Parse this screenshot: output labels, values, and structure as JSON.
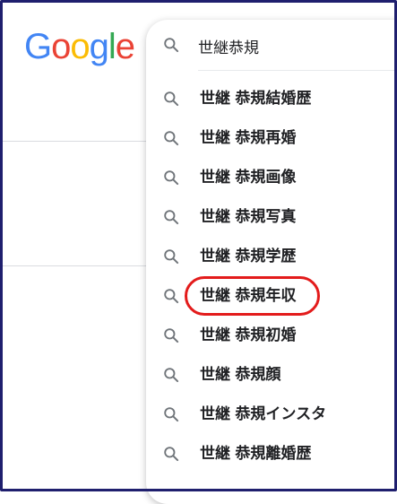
{
  "logo": {
    "text": "Google",
    "letters": [
      {
        "ch": "G",
        "color": "#4285F4"
      },
      {
        "ch": "o",
        "color": "#EA4335"
      },
      {
        "ch": "o",
        "color": "#FBBC05"
      },
      {
        "ch": "g",
        "color": "#4285F4"
      },
      {
        "ch": "l",
        "color": "#34A853"
      },
      {
        "ch": "e",
        "color": "#EA4335"
      }
    ]
  },
  "search": {
    "value": "世継恭規",
    "icon": "search-icon"
  },
  "suggestions": [
    {
      "query": "世継",
      "completion": "恭規結婚歴"
    },
    {
      "query": "世継",
      "completion": "恭規再婚"
    },
    {
      "query": "世継",
      "completion": "恭規画像"
    },
    {
      "query": "世継",
      "completion": "恭規写真"
    },
    {
      "query": "世継",
      "completion": "恭規学歴"
    },
    {
      "query": "世継",
      "completion": "恭規年収",
      "highlighted": true
    },
    {
      "query": "世継",
      "completion": "恭規初婚"
    },
    {
      "query": "世継",
      "completion": "恭規顔"
    },
    {
      "query": "世継",
      "completion": "恭規インスタ"
    },
    {
      "query": "世継",
      "completion": "恭規離婚歴"
    }
  ],
  "colors": {
    "highlight_ring": "#e31b1b",
    "frame": "#1f1f6e",
    "icon": "#70757a"
  }
}
